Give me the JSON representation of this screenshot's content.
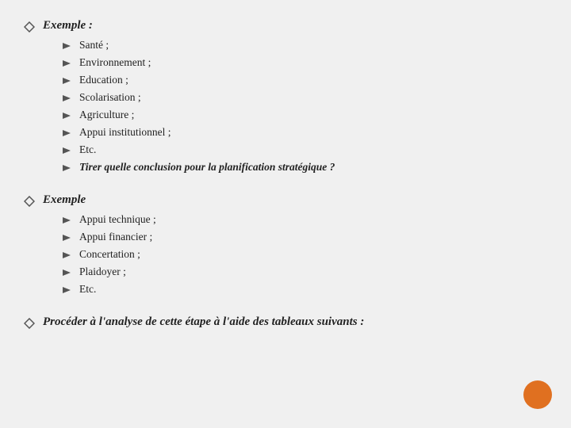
{
  "sections": [
    {
      "id": "exemple1",
      "title": "Exemple :",
      "items": [
        {
          "text": "Santé ;",
          "italic": false
        },
        {
          "text": "Environnement ;",
          "italic": false
        },
        {
          "text": "Education ;",
          "italic": false
        },
        {
          "text": "Scolarisation ;",
          "italic": false
        },
        {
          "text": "Agriculture ;",
          "italic": false
        },
        {
          "text": "Appui institutionnel ;",
          "italic": false
        },
        {
          "text": "Etc.",
          "italic": false
        },
        {
          "text": "Tirer  quelle conclusion pour la planification stratégique ?",
          "italic": true
        }
      ]
    },
    {
      "id": "exemple2",
      "title": "Exemple",
      "items": [
        {
          "text": "Appui technique ;",
          "italic": false
        },
        {
          "text": "Appui financier ;",
          "italic": false
        },
        {
          "text": "Concertation ;",
          "italic": false
        },
        {
          "text": "Plaidoyer ;",
          "italic": false
        },
        {
          "text": "Etc.",
          "italic": false
        }
      ]
    }
  ],
  "bottom_text": "Procéder à l'analyse de cette étape  à l'aide des tableaux suivants :",
  "icons": {
    "diamond": "diamond-icon",
    "arrow": "arrow-bullet-icon"
  }
}
